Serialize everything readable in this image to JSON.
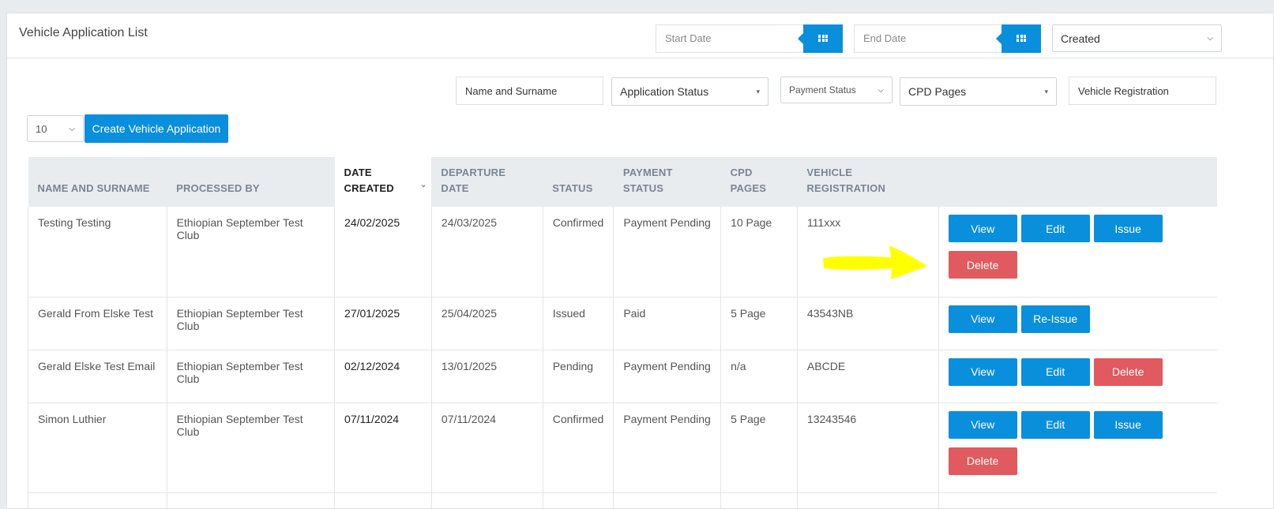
{
  "panel": {
    "title": "Vehicle Application List"
  },
  "filters": {
    "start_date_placeholder": "Start Date",
    "end_date_placeholder": "End Date",
    "date_type_value": "Created",
    "name_placeholder": "Name and Surname",
    "application_status": "Application Status",
    "payment_status": "Payment Status",
    "cpd_pages": "CPD Pages",
    "vehicle_registration_placeholder": "Vehicle Registration",
    "page_size": "10",
    "create_label": "Create Vehicle Application"
  },
  "table": {
    "columns": [
      "NAME AND SURNAME",
      "PROCESSED BY",
      "DATE CREATED",
      "DEPARTURE DATE",
      "STATUS",
      "PAYMENT STATUS",
      "CPD PAGES",
      "VEHICLE REGISTRATION"
    ],
    "col_lines": {
      "name": [
        "NAME AND SURNAME"
      ],
      "processed": [
        "PROCESSED BY"
      ],
      "created": [
        "DATE",
        "CREATED"
      ],
      "departure": [
        "DEPARTURE",
        "DATE"
      ],
      "status": [
        "STATUS"
      ],
      "payment": [
        "PAYMENT",
        "STATUS"
      ],
      "cpd": [
        "CPD",
        "PAGES"
      ],
      "vehicle": [
        "VEHICLE",
        "REGISTRATION"
      ]
    },
    "rows": [
      {
        "name": "Testing Testing",
        "processed_by": "Ethiopian September Test Club",
        "date_created": "24/02/2025",
        "departure_date": "24/03/2025",
        "status": "Confirmed",
        "payment_status": "Payment Pending",
        "cpd_pages": "10 Page",
        "vehicle_registration": "111xxx"
      },
      {
        "name": "Gerald From Elske Test",
        "processed_by": "Ethiopian September Test Club",
        "date_created": "27/01/2025",
        "departure_date": "25/04/2025",
        "status": "Issued",
        "payment_status": "Paid",
        "cpd_pages": "5 Page",
        "vehicle_registration": "43543NB"
      },
      {
        "name": "Gerald Elske Test Email",
        "processed_by": "Ethiopian September Test Club",
        "date_created": "02/12/2024",
        "departure_date": "13/01/2025",
        "status": "Pending",
        "payment_status": "Payment Pending",
        "cpd_pages": "n/a",
        "vehicle_registration": "ABCDE"
      },
      {
        "name": "Simon Luthier",
        "processed_by": "Ethiopian September Test Club",
        "date_created": "07/11/2024",
        "departure_date": "07/11/2024",
        "status": "Confirmed",
        "payment_status": "Payment Pending",
        "cpd_pages": "5 Page",
        "vehicle_registration": "13243546"
      }
    ]
  },
  "actions": {
    "view": "View",
    "edit": "Edit",
    "issue": "Issue",
    "delete": "Delete",
    "reissue": "Re-Issue"
  },
  "annotation": {
    "arrow_color": "#ffff00"
  },
  "colors": {
    "primary": "#0a8fdc",
    "danger": "#e05a5f"
  }
}
